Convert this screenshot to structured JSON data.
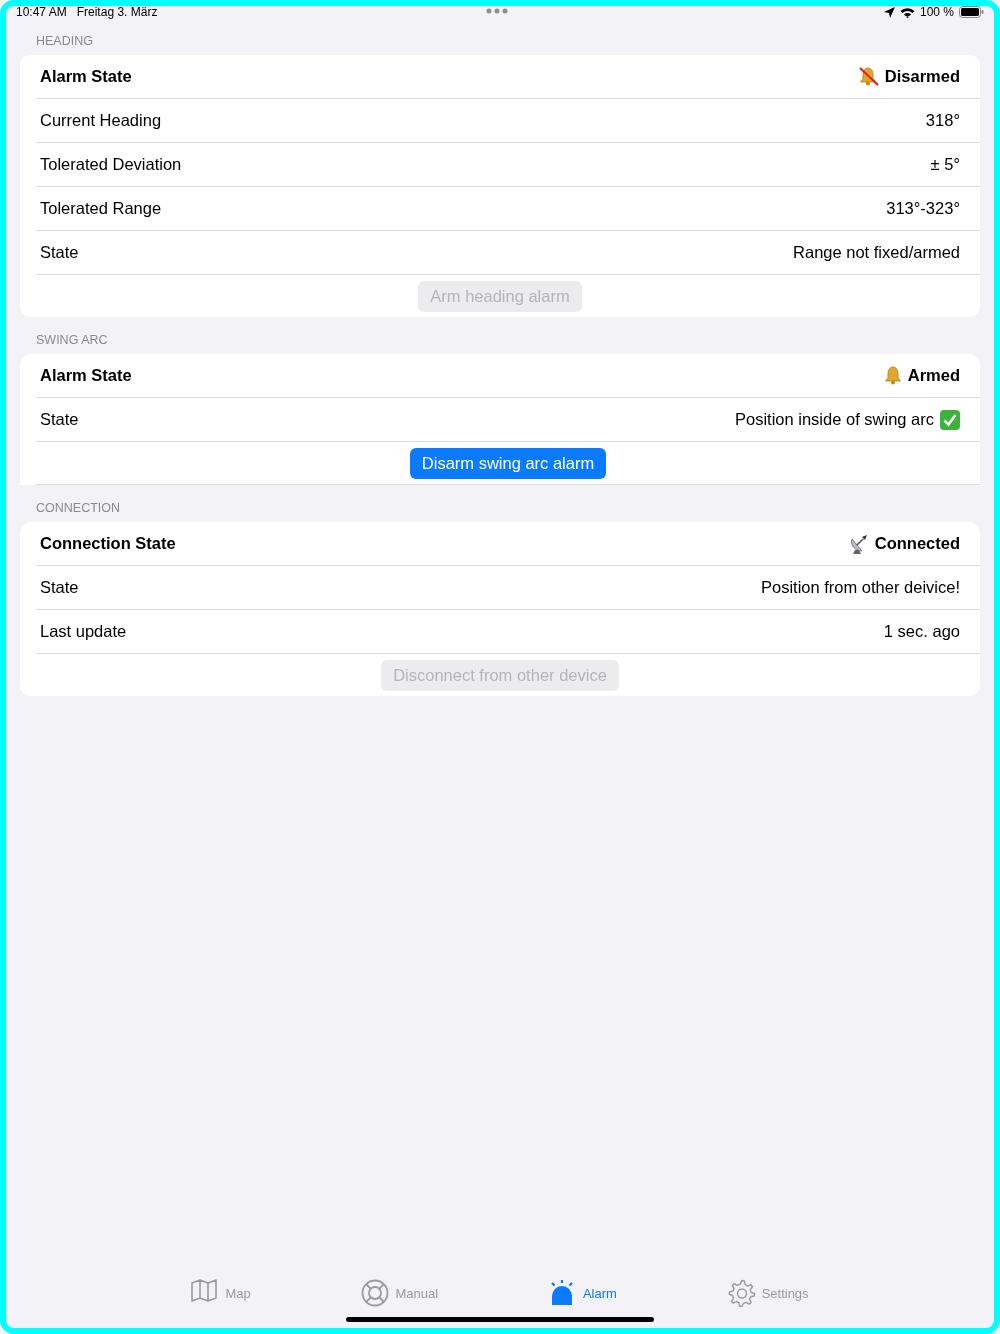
{
  "status_bar": {
    "time": "10:47 AM",
    "date": "Freitag 3. März",
    "battery": "100 %"
  },
  "sections": [
    {
      "header": "HEADING",
      "rows": [
        {
          "kind": "alarm",
          "label": "Alarm State",
          "value": "Disarmed",
          "armed": false
        },
        {
          "kind": "value",
          "label": "Current Heading",
          "value": "318°"
        },
        {
          "kind": "value",
          "label": "Tolerated Deviation",
          "value": "± 5°"
        },
        {
          "kind": "value",
          "label": "Tolerated Range",
          "value": "313°-323°"
        },
        {
          "kind": "value",
          "label": "State",
          "value": "Range not fixed/armed"
        }
      ],
      "button": {
        "label": "Arm heading alarm",
        "disabled": true
      }
    },
    {
      "header": "SWING ARC",
      "rows": [
        {
          "kind": "alarm",
          "label": "Alarm State",
          "value": "Armed",
          "armed": true
        },
        {
          "kind": "value",
          "label": "State",
          "value": "Position inside of swing arc",
          "check": true
        }
      ],
      "button": {
        "label": "Disarm swing arc alarm",
        "disabled": false
      }
    },
    {
      "header": "CONNECTION",
      "rows": [
        {
          "kind": "connection",
          "label": "Connection State",
          "value": "Connected"
        },
        {
          "kind": "value",
          "label": "State",
          "value": "Position from other deivice!"
        },
        {
          "kind": "value",
          "label": "Last update",
          "value": "1 sec. ago"
        }
      ],
      "button": {
        "label": "Disconnect from other device",
        "disabled": true
      }
    }
  ],
  "tabs": [
    {
      "kind": "map",
      "label": "Map",
      "selected": false
    },
    {
      "kind": "manual",
      "label": "Manual",
      "selected": false
    },
    {
      "kind": "alarm",
      "label": "Alarm",
      "selected": true
    },
    {
      "kind": "settings",
      "label": "Settings",
      "selected": false
    }
  ]
}
